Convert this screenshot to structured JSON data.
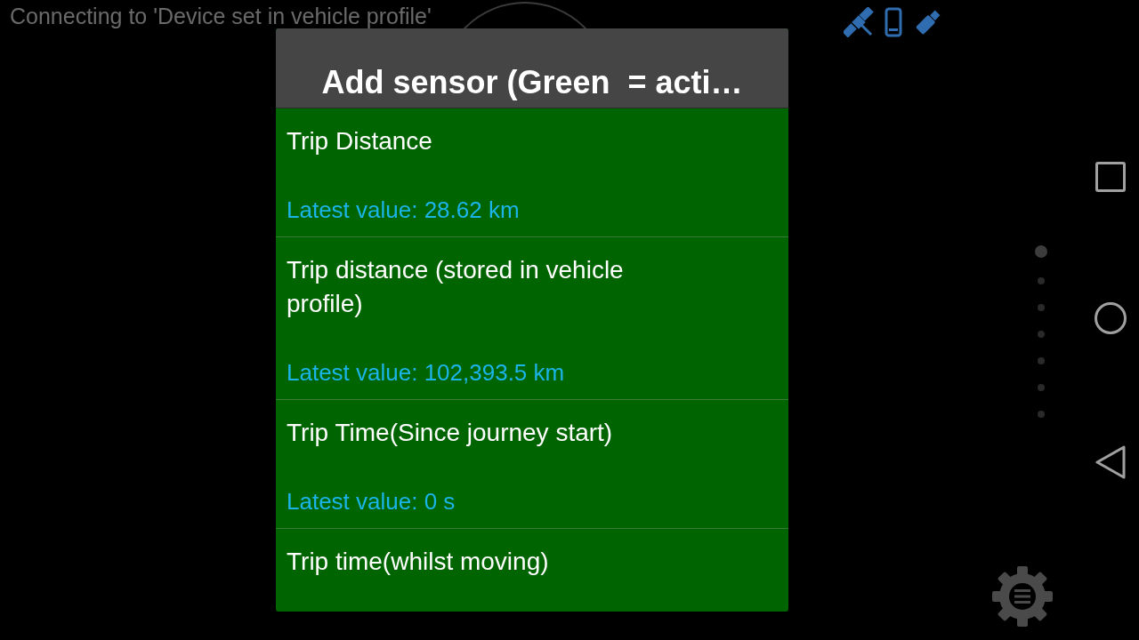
{
  "status_text": "Connecting to 'Device set in vehicle profile'",
  "dialog": {
    "title": "Add sensor (Green  = acti…",
    "items": [
      {
        "name": "Trip Distance",
        "value": "Latest value: 28.62 km",
        "active": true
      },
      {
        "name": "Trip distance (stored in vehicle profile)",
        "value": "Latest value: 102,393.5 km",
        "active": true
      },
      {
        "name": "Trip Time(Since journey start)",
        "value": "Latest value: 0 s",
        "active": true
      },
      {
        "name": "Trip time(whilst moving)",
        "active": true
      }
    ]
  },
  "pages": [
    {
      "selected": true
    },
    {
      "selected": false
    },
    {
      "selected": false
    },
    {
      "selected": false
    },
    {
      "selected": false
    },
    {
      "selected": false
    },
    {
      "selected": false
    }
  ]
}
